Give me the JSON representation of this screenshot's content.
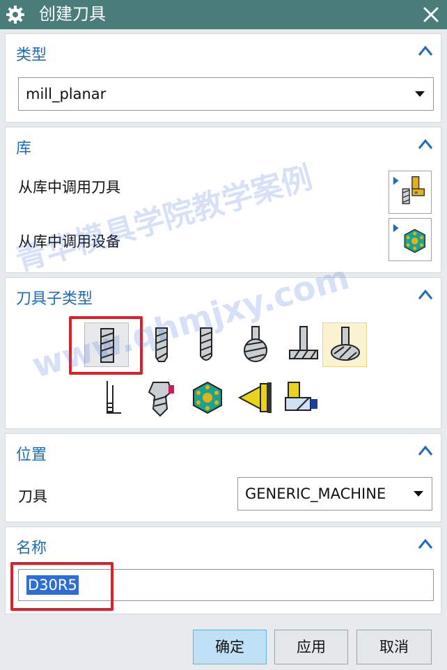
{
  "window": {
    "title": "创建刀具"
  },
  "type_section": {
    "header": "类型",
    "value": "mill_planar"
  },
  "library_section": {
    "header": "库",
    "retrieve_tool_label": "从库中调用刀具",
    "retrieve_device_label": "从库中调用设备"
  },
  "tool_subtype_section": {
    "header": "刀具子类型"
  },
  "location_section": {
    "header": "位置",
    "tool_label": "刀具",
    "tool_value": "GENERIC_MACHINE"
  },
  "name_section": {
    "header": "名称",
    "value": "D30R5"
  },
  "buttons": {
    "ok": "确定",
    "apply": "应用",
    "cancel": "取消"
  },
  "watermark": {
    "line1": "青华模具学院教学案例",
    "line2": "www.qhmjxy.com"
  },
  "colors": {
    "titlebar": "#4a7d79",
    "section_header": "#1f6bb6",
    "selection": "#2f6fd5",
    "highlight_box": "#e41e26",
    "primary_button": "#bfe0f5"
  }
}
